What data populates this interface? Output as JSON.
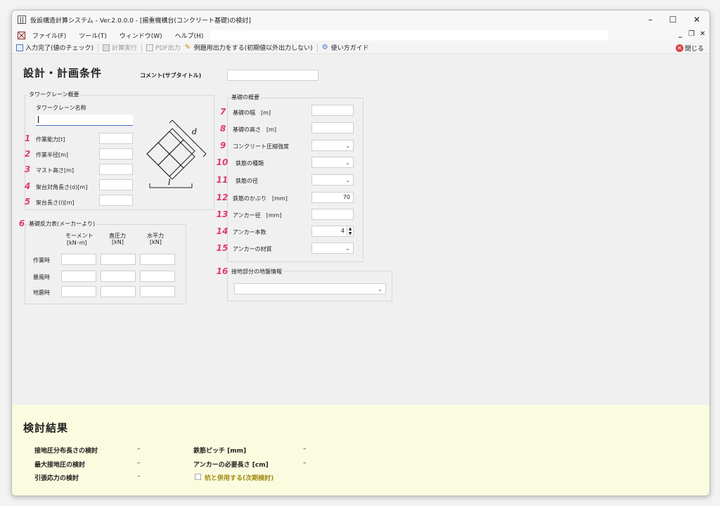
{
  "window": {
    "title": "仮設構造計算システム - Ver.2.0.0.0 - [揚重機構台(コンクリート基礎)の検討]"
  },
  "menu": {
    "items": [
      "ファイル(F)",
      "ツール(T)",
      "ウィンドウ(W)",
      "ヘルプ(H)"
    ]
  },
  "toolbar": {
    "input_complete": "入力完了(値のチェック)",
    "calc": "計算実行",
    "pdf": "PDF出力",
    "example_output": "例題用出力をする(初期値以外出力しない)",
    "guide": "使い方ガイド",
    "close": "閉じる"
  },
  "form": {
    "heading": "設計・計画条件",
    "comment_label": "コメント(サブタイトル)",
    "comment_value": "",
    "crane_group_title": "タワークレーン概要",
    "crane_name_label": "タワークレーン名称",
    "crane_name_value": "",
    "crane_fields": [
      {
        "num": "1",
        "label": "作業能力[t]",
        "value": ""
      },
      {
        "num": "2",
        "label": "作業半径[m]",
        "value": ""
      },
      {
        "num": "3",
        "label": "マスト高さ[m]",
        "value": ""
      },
      {
        "num": "4",
        "label": "架台対角長さ(d)[m]",
        "value": ""
      },
      {
        "num": "5",
        "label": "架台長さ(l)[m]",
        "value": ""
      }
    ],
    "diagram_labels": {
      "d": "d",
      "l": "l"
    },
    "reaction_group_num": "6",
    "reaction_group_title": "基礎反力表(メーカーより)",
    "reaction_cols": [
      {
        "name": "モーメント",
        "unit": "[kN･m]"
      },
      {
        "name": "直圧力",
        "unit": "[kN]"
      },
      {
        "name": "水平力",
        "unit": "[kN]"
      }
    ],
    "reaction_rows": [
      "作業時",
      "暴風時",
      "地震時"
    ],
    "foundation_group_title": "基礎の概要",
    "foundation_fields": [
      {
        "num": "7",
        "label": "基礎の幅　[m]",
        "value": "",
        "type": "text"
      },
      {
        "num": "8",
        "label": "基礎の高さ　[m]",
        "value": "",
        "type": "text"
      },
      {
        "num": "9",
        "label": "コンクリート圧縮強度",
        "value": "",
        "type": "select"
      },
      {
        "num": "10",
        "label": "鉄筋の種類",
        "value": "",
        "type": "select"
      },
      {
        "num": "11",
        "label": "鉄筋の径",
        "value": "",
        "type": "select"
      },
      {
        "num": "12",
        "label": "鉄筋のかぶり　[mm]",
        "value": "70",
        "type": "text"
      },
      {
        "num": "13",
        "label": "アンカー径　[mm]",
        "value": "",
        "type": "text"
      },
      {
        "num": "14",
        "label": "アンカー本数",
        "value": "4",
        "type": "spin"
      },
      {
        "num": "15",
        "label": "アンカーの材質",
        "value": "",
        "type": "select"
      }
    ],
    "ground_num": "16",
    "ground_title": "接地部分の地盤情報",
    "ground_value": ""
  },
  "results": {
    "heading": "検討結果",
    "left": [
      {
        "label": "接地圧分布長さの検討",
        "value": "–"
      },
      {
        "label": "最大接地圧の検討",
        "value": "–"
      },
      {
        "label": "引張応力の検討",
        "value": "–"
      }
    ],
    "right": [
      {
        "label": "鉄筋ピッチ [mm]",
        "value": "–"
      },
      {
        "label": "アンカーの必要長さ [cm]",
        "value": "–"
      }
    ],
    "pile_checkbox_label": "杭と併用する(次期検討)"
  }
}
